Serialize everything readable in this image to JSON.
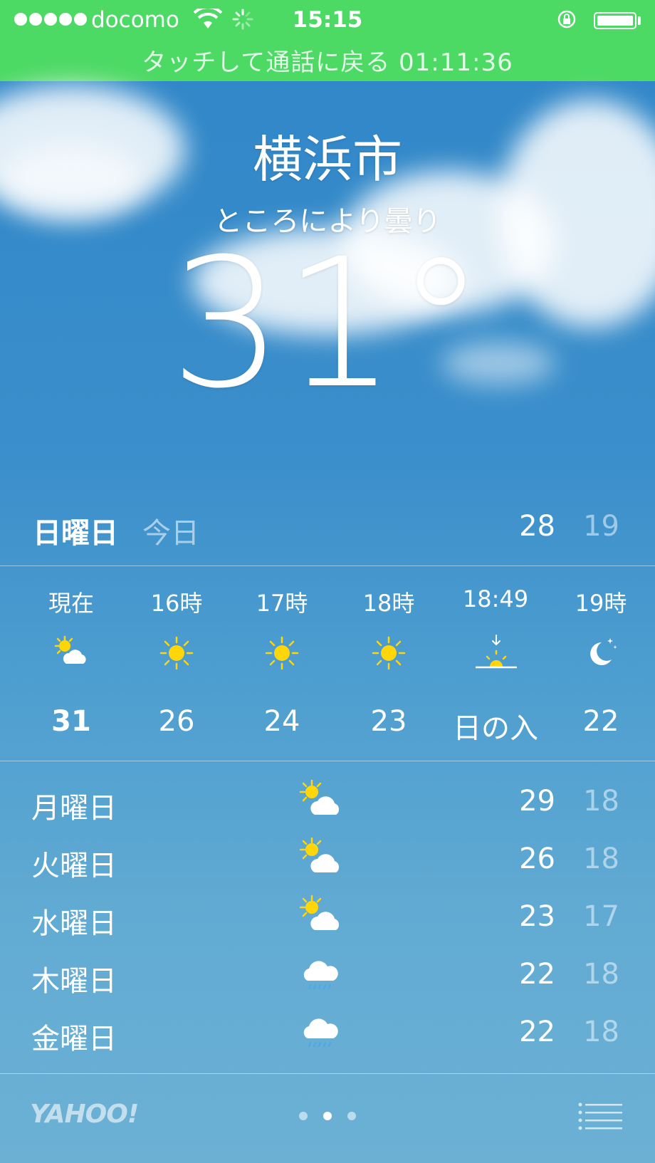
{
  "status_bar": {
    "carrier": "docomo",
    "time": "15:15",
    "call_banner": "タッチして通話に戻る 01:11:36",
    "background_color": "#4cd964"
  },
  "location": {
    "city": "横浜市",
    "condition": "ところにより曇り",
    "temperature": "31°"
  },
  "today": {
    "day": "日曜日",
    "label": "今日",
    "high": "28",
    "low": "19"
  },
  "hourly": [
    {
      "label": "現在",
      "icon": "sun-cloud-icon",
      "temp": "31"
    },
    {
      "label": "16時",
      "icon": "sun-icon",
      "temp": "26"
    },
    {
      "label": "17時",
      "icon": "sun-icon",
      "temp": "24"
    },
    {
      "label": "18時",
      "icon": "sun-icon",
      "temp": "23"
    },
    {
      "label": "18:49",
      "icon": "sunset-icon",
      "temp": "日の入"
    },
    {
      "label": "19時",
      "icon": "moon-icon",
      "temp": "22"
    }
  ],
  "daily": [
    {
      "day": "月曜日",
      "icon": "sun-cloud-icon",
      "high": "29",
      "low": "18"
    },
    {
      "day": "火曜日",
      "icon": "sun-cloud-icon",
      "high": "26",
      "low": "18"
    },
    {
      "day": "水曜日",
      "icon": "sun-cloud-icon",
      "high": "23",
      "low": "17"
    },
    {
      "day": "木曜日",
      "icon": "rain-icon",
      "high": "22",
      "low": "18"
    },
    {
      "day": "金曜日",
      "icon": "rain-icon",
      "high": "22",
      "low": "18"
    }
  ],
  "footer": {
    "logo": "YAHOO!",
    "page_count": 3,
    "active_page": 2
  },
  "colors": {
    "sun": "#ffd60a",
    "sky_top": "#2f86c8",
    "sky_bottom": "#6cb1d4"
  }
}
